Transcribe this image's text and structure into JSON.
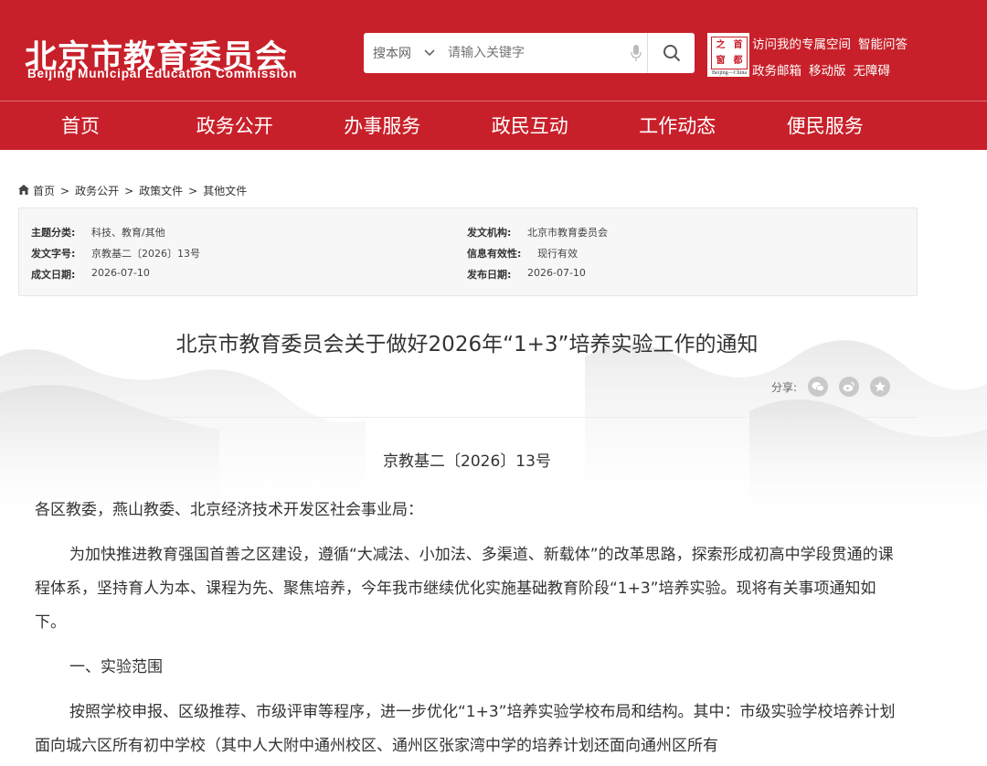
{
  "header": {
    "logo_cn": "北京市教育委员会",
    "logo_en": "Beijing Municipal Education Commission",
    "search_scope": "搜本网",
    "search_placeholder": "请输入关键字",
    "seal_chars": [
      "之",
      "首",
      "窗",
      "都"
    ],
    "seal_en": "Beijing—China",
    "links_row1": [
      "访问我的专属空间",
      "智能问答"
    ],
    "links_row2": [
      "政务邮箱",
      "移动版",
      "无障碍"
    ]
  },
  "nav": [
    "首页",
    "政务公开",
    "办事服务",
    "政民互动",
    "工作动态",
    "便民服务"
  ],
  "breadcrumb": [
    "首页",
    "政务公开",
    "政策文件",
    "其他文件"
  ],
  "info": {
    "topic_label": "主题分类:",
    "topic_value": "科技、教育/其他",
    "doc_num_label": "发文字号:",
    "doc_num_value": "京教基二〔2026〕13号",
    "date_label": "成文日期:",
    "date_value": "2026-07-10",
    "org_label": "发文机构:",
    "org_value": "北京市教育委员会",
    "valid_label": "信息有效性:",
    "valid_value": "现行有效",
    "pub_label": "发布日期:",
    "pub_value": "2026-07-10"
  },
  "article": {
    "title": "北京市教育委员会关于做好2026年“1+3”培养实验工作的通知",
    "share_label": "分享:",
    "doc_no": "京教基二〔2026〕13号",
    "paragraphs": [
      "各区教委，燕山教委、北京经济技术开发区社会事业局：",
      "为加快推进教育强国首善之区建设，遵循“大减法、小加法、多渠道、新载体”的改革思路，探索形成初高中学段贯通的课程体系，坚持育人为本、课程为先、聚焦培养，今年我市继续优化实施基础教育阶段“1+3”培养实验。现将有关事项通知如下。",
      "一、实验范围",
      "按照学校申报、区级推荐、市级评审等程序，进一步优化“1+3”培养实验学校布局和结构。其中：市级实验学校培养计划面向城六区所有初中学校（其中人大附中通州校区、通州区张家湾中学的培养计划还面向通州区所有"
    ]
  }
}
